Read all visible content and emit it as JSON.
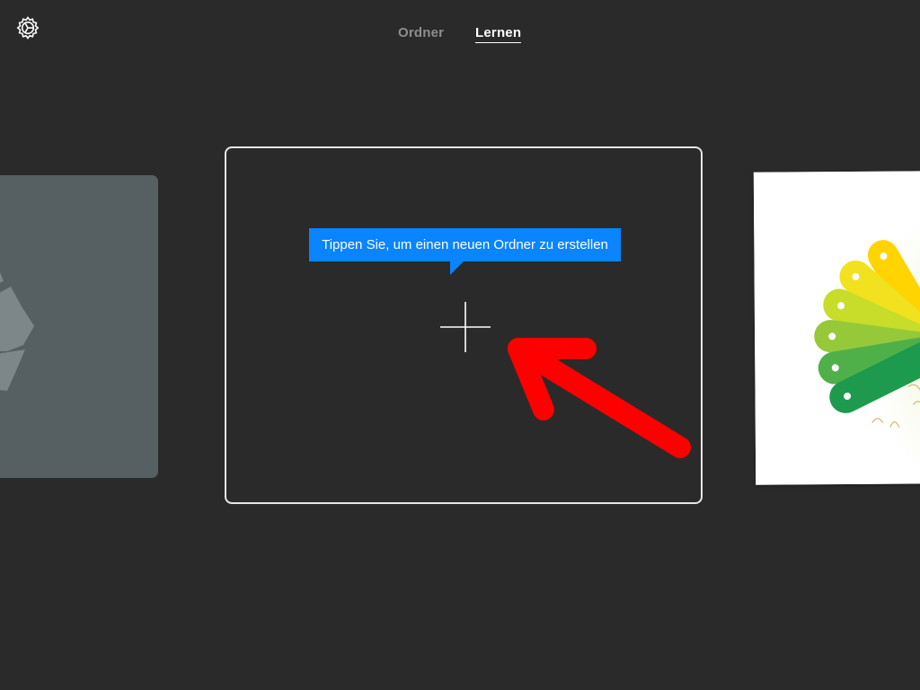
{
  "header": {
    "settings_icon": "gear-icon",
    "tabs": [
      {
        "label": "Ordner",
        "selected": false
      },
      {
        "label": "Lernen",
        "selected": true
      }
    ]
  },
  "carousel": {
    "left_card_icon": "recycle-icon",
    "center_card": {
      "icon": "plus-icon",
      "tooltip": "Tippen Sie, um einen neuen Ordner zu erstellen"
    },
    "right_card_image": "color-fan-illustration"
  },
  "annotation": {
    "arrow_color": "#ff0000"
  },
  "colors": {
    "background": "#2a2a2a",
    "tooltip": "#0a84ff",
    "left_card": "#566062",
    "tab_active": "#ffffff",
    "tab_inactive": "#8e8e8e"
  }
}
